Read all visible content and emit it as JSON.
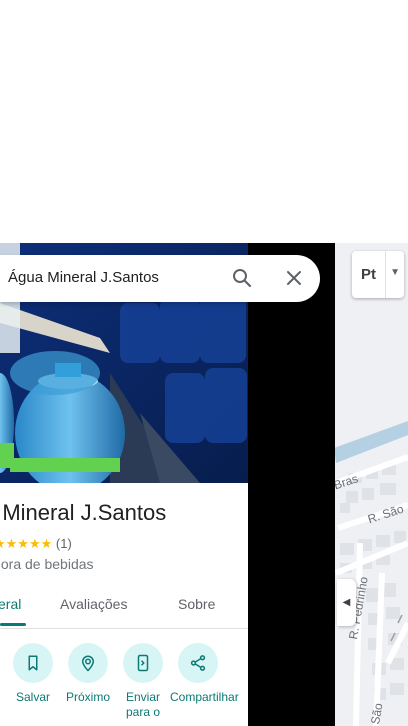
{
  "search": {
    "query": "Água Mineral J.Santos"
  },
  "place": {
    "name": "a Mineral J.Santos",
    "stars": "★★★★★",
    "review_count": "(1)",
    "category": "idora de bebidas"
  },
  "tabs": [
    {
      "label": "eral",
      "active": true
    },
    {
      "label": "Avaliações",
      "active": false
    },
    {
      "label": "Sobre",
      "active": false
    }
  ],
  "actions": [
    {
      "label": "Salvar",
      "icon": "bookmark-icon"
    },
    {
      "label": "Próximo",
      "icon": "nearby-icon"
    },
    {
      "label": "Enviar para o",
      "icon": "send-to-phone-icon"
    },
    {
      "label": "Compartilhar",
      "icon": "share-icon"
    }
  ],
  "map": {
    "layer_button_label": "Pt",
    "streets": [
      "Bras",
      "R. São",
      "R. Pedrinho",
      "São"
    ]
  },
  "colors": {
    "accent": "#0b7a75",
    "star": "#fbbc04",
    "action_bg": "#d8f5f6"
  }
}
